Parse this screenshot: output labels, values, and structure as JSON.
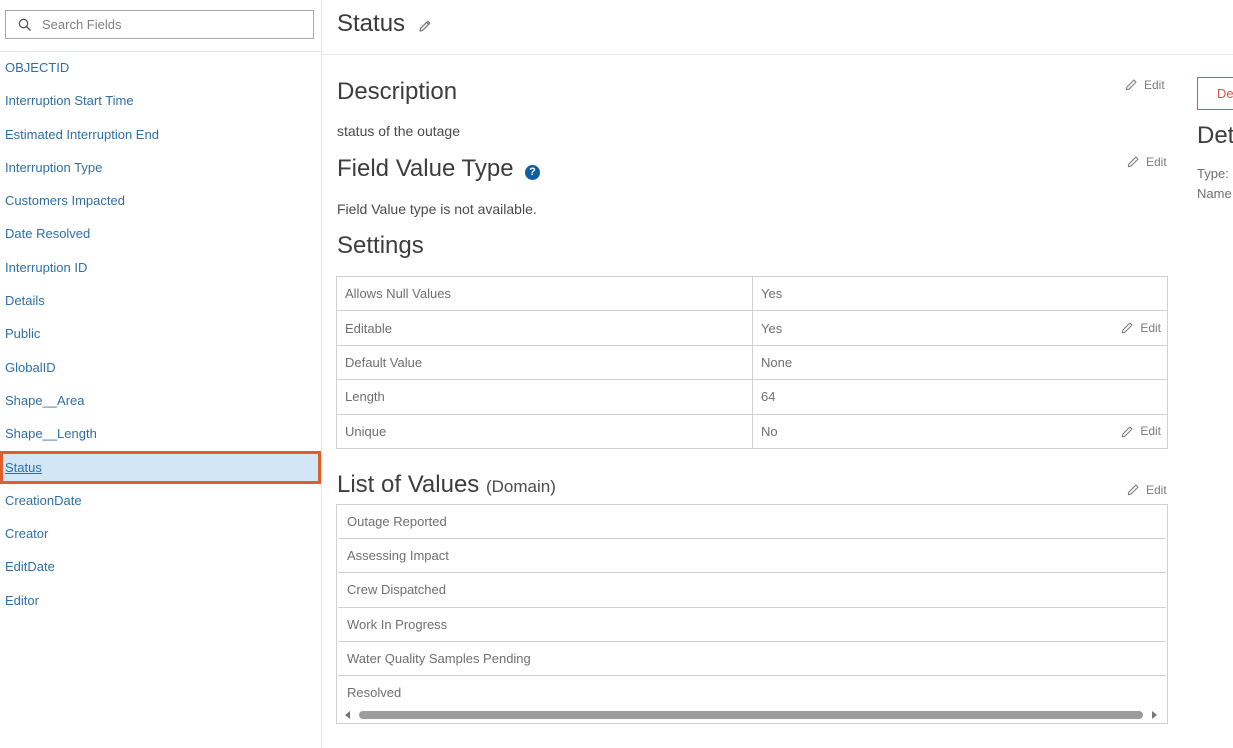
{
  "search": {
    "placeholder": "Search Fields"
  },
  "fields": [
    "OBJECTID",
    "Interruption Start Time",
    "Estimated Interruption End",
    "Interruption Type",
    "Customers Impacted",
    "Date Resolved",
    "Interruption ID",
    "Details",
    "Public",
    "GlobalID",
    "Shape__Area",
    "Shape__Length",
    "Status",
    "CreationDate",
    "Creator",
    "EditDate",
    "Editor"
  ],
  "selected_field": "Status",
  "header": {
    "title": "Status"
  },
  "description": {
    "title": "Description",
    "text": "status of the outage",
    "edit_label": "Edit"
  },
  "field_value_type": {
    "title": "Field Value Type",
    "help_glyph": "?",
    "text": "Field Value type is not available.",
    "edit_label": "Edit"
  },
  "settings": {
    "title": "Settings",
    "rows": [
      {
        "key": "Allows Null Values",
        "value": "Yes",
        "edit": ""
      },
      {
        "key": "Editable",
        "value": "Yes",
        "edit": "Edit"
      },
      {
        "key": "Default Value",
        "value": "None",
        "edit": ""
      },
      {
        "key": "Length",
        "value": "64",
        "edit": ""
      },
      {
        "key": "Unique",
        "value": "No",
        "edit": "Edit"
      }
    ]
  },
  "domain": {
    "title": "List of Values",
    "subtitle": "(Domain)",
    "edit_label": "Edit",
    "values": [
      "Outage Reported",
      "Assessing Impact",
      "Crew Dispatched",
      "Work In Progress",
      "Water Quality Samples Pending",
      "Resolved"
    ]
  },
  "right_panel": {
    "delete_label": "De",
    "details_title": "Det",
    "type_label": "Type:",
    "name_label": "Name"
  },
  "colors": {
    "link": "#2f6fa8",
    "selection_bg": "#d3e6f5",
    "selection_border": "#e35d2c",
    "help": "#0d5ea7",
    "delete": "#d9534f"
  }
}
